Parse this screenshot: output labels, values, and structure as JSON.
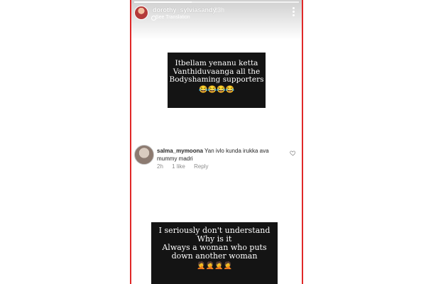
{
  "story": {
    "username": "dorothy_sylviasandy",
    "time": "23h",
    "translation_label": "See Translation",
    "progress": 0.35
  },
  "caption_top": {
    "lines": [
      "Itbellam yenanu ketta",
      "Vanthiduvaanga all the",
      "Bodyshaming supporters"
    ],
    "emoji": "😂😂😂😂"
  },
  "comment": {
    "username": "salma_mymoona",
    "text": "Yan ivlo kunda irukka ava mummy madri",
    "age": "2h",
    "likes": "1 like",
    "reply": "Reply"
  },
  "caption_bottom": {
    "lines": [
      "I seriously don't understand",
      "Why is it",
      "Always a woman who puts",
      "down another woman"
    ],
    "emoji": "🤦🤦🤦🤦"
  },
  "icons": {
    "more": "more-vertical-icon",
    "like": "heart-outline-icon",
    "globe": "globe-icon"
  },
  "colors": {
    "frame_border": "#e02828",
    "caption_bg": "#141414"
  }
}
